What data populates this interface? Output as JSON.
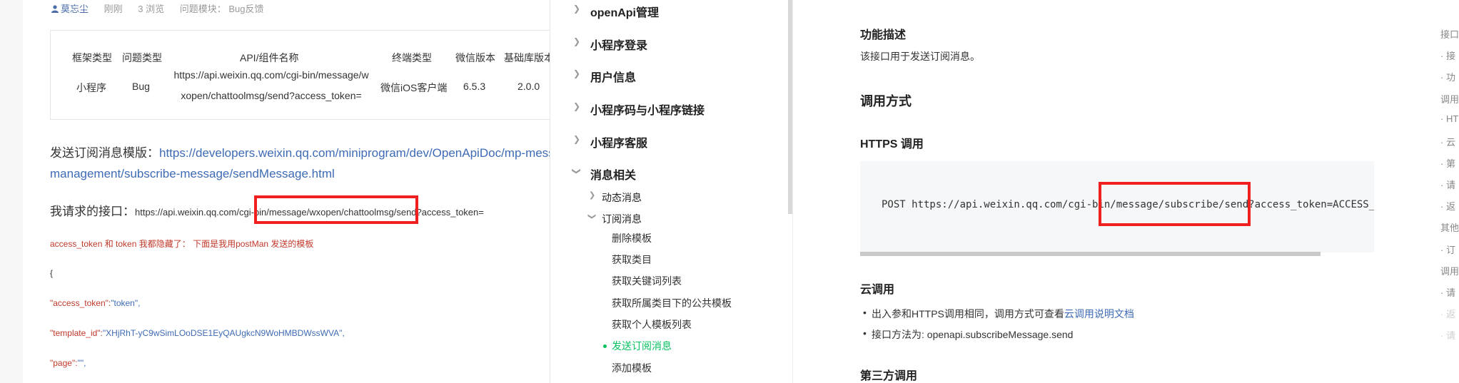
{
  "post": {
    "author": "莫忘尘",
    "time": "刚刚",
    "views": "3 浏览",
    "module": "问题模块：  Bug反馈",
    "table": {
      "headers": [
        "框架类型",
        "问题类型",
        "API/组件名称",
        "终端类型",
        "微信版本",
        "基础库版本"
      ],
      "row": {
        "framework": "小程序",
        "issue_type": "Bug",
        "api_line1": "https://api.weixin.qq.com/cgi-bin/message/w",
        "api_line2": "xopen/chattoolmsg/send?access_token=",
        "terminal": "微信iOS客户端",
        "wechat_version": "6.5.3",
        "lib_version": "2.0.0"
      }
    },
    "template_label": "发送订阅消息模版：",
    "template_link_line1": "https://developers.weixin.qq.com/miniprogram/dev/OpenApiDoc/mp-message-",
    "template_link_line2": "management/subscribe-message/sendMessage.html",
    "request_label": "我请求的接口：",
    "request_url": "https://api.weixin.qq.com/cgi-bin/message/wxopen/chattoolmsg/send?access_token=",
    "note": "access_token 和 token 我都隐藏了：  下面是我用postMan 发送的模板",
    "code": {
      "open_brace": "{",
      "access_token_key": "\"access_token\":",
      "access_token_val": "\"token\",",
      "template_id_key": "\"template_id\":",
      "template_id_val": "\"XHjRhT-yC9wSimLOoDSE1EyQAUgkcN9WoHMBDWssWVA\",",
      "page_key": "\"page\":",
      "page_val": "\"\","
    }
  },
  "nav": {
    "items": [
      {
        "label": "openApi管理",
        "level": 1,
        "chevron": "chevron-right"
      },
      {
        "label": "小程序登录",
        "level": 1,
        "chevron": "chevron-right"
      },
      {
        "label": "用户信息",
        "level": 1,
        "chevron": "chevron-right"
      },
      {
        "label": "小程序码与小程序链接",
        "level": 1,
        "chevron": "chevron-right"
      },
      {
        "label": "小程序客服",
        "level": 1,
        "chevron": "chevron-right"
      },
      {
        "label": "消息相关",
        "level": 1,
        "chevron": "chevron-down"
      },
      {
        "label": "动态消息",
        "level": 2,
        "chevron": "chevron-right"
      },
      {
        "label": "订阅消息",
        "level": 2,
        "chevron": "chevron-down"
      },
      {
        "label": "删除模板",
        "level": 3
      },
      {
        "label": "获取类目",
        "level": 3
      },
      {
        "label": "获取关键词列表",
        "level": 3
      },
      {
        "label": "获取所属类目下的公共模板",
        "level": 3
      },
      {
        "label": "获取个人模板列表",
        "level": 3
      },
      {
        "label": "发送订阅消息",
        "level": 3,
        "active": true
      },
      {
        "label": "添加模板",
        "level": 3
      }
    ],
    "active_color": "#07c160"
  },
  "doc": {
    "func_title": "功能描述",
    "func_desc": "该接口用于发送订阅消息。",
    "call_title": "调用方式",
    "https_title": "HTTPS 调用",
    "https_code": "POST https://api.weixin.qq.com/cgi-bin/message/subscribe/send?access_token=ACCESS_",
    "cloud_title": "云调用",
    "cloud_bullet1_text": "出入参和HTTPS调用相同，调用方式可查看",
    "cloud_bullet1_link": "云调用说明文档",
    "cloud_bullet2": "接口方法为: openapi.subscribeMessage.send",
    "third_title": "第三方调用"
  },
  "toc": {
    "items": [
      "接口",
      "· 接",
      "· 功",
      "调用",
      "· HT",
      "· 云",
      "· 第",
      "· 请",
      "· 返",
      "其他",
      "· 订",
      "调用",
      "· 请",
      "· 返",
      "· 请"
    ]
  },
  "colors": {
    "highlight": "#f02020",
    "link": "#3e6bb4",
    "key_red": "#c0392b"
  }
}
